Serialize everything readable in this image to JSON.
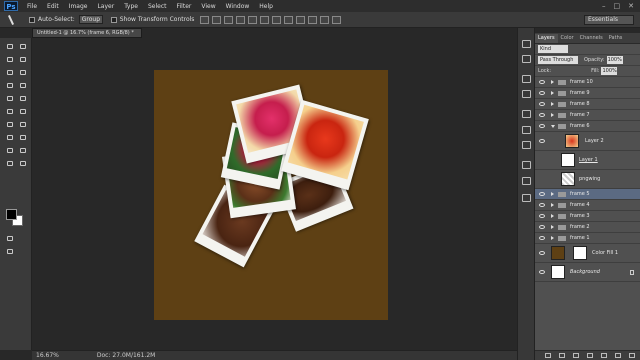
{
  "app": {
    "logo": "Ps"
  },
  "menu": [
    "File",
    "Edit",
    "Image",
    "Layer",
    "Type",
    "Select",
    "Filter",
    "View",
    "Window",
    "Help"
  ],
  "window_controls": [
    "–",
    "□",
    "✕"
  ],
  "options": {
    "auto_select_label": "Auto-Select:",
    "auto_select_value": "Group",
    "transform_label": "Show Transform Controls",
    "workspace": "Essentials"
  },
  "document": {
    "tab_title": "Untitled-1 @ 16.7% (frame 6, RGB/8) *"
  },
  "status": {
    "zoom": "16.67%",
    "doc": "Doc: 27.0M/161.2M"
  },
  "swatches": {
    "foreground": "#000000",
    "background": "#ffffff"
  },
  "panel": {
    "tabs": [
      "Layers",
      "Color",
      "Channels",
      "Paths"
    ],
    "active_tab": "Layers",
    "kind_label": "Kind",
    "blend_mode": "Pass Through",
    "opacity_label": "Opacity:",
    "opacity_value": "100%",
    "lock_label": "Lock:",
    "fill_label": "Fill:",
    "fill_value": "100%",
    "layers": {
      "frame10": "frame 10",
      "frame9": "frame 9",
      "frame8": "frame 8",
      "frame7": "frame 7",
      "frame6": "frame 6",
      "layer2": "Layer 2",
      "layer1": "Layer 1",
      "pngwing": "pngwing",
      "frame5": "frame 5",
      "frame4": "frame 4",
      "frame3": "frame 3",
      "frame2": "frame 2",
      "frame1": "frame 1",
      "colorfill": "Color Fill 1",
      "background": "Background"
    }
  },
  "colors": {
    "canvas_fill": "#5e4014",
    "selected_layer": "#5b6a82",
    "frame_paper": "#f4f4f0"
  }
}
